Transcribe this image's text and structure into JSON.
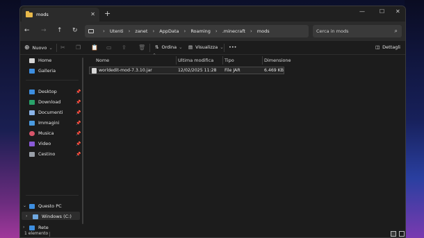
{
  "window": {
    "tab_title": "mods",
    "new_tab_symbol": "+",
    "minimize_symbol": "—",
    "maximize_symbol": "☐",
    "close_symbol": "✕"
  },
  "nav": {
    "back": "←",
    "forward": "→",
    "up": "↑",
    "refresh": "↻"
  },
  "breadcrumb": [
    "Utenti",
    "zanet",
    "AppData",
    "Roaming",
    ".minecraft",
    "mods"
  ],
  "search": {
    "placeholder": "Cerca in mods"
  },
  "toolbar": {
    "new_label": "Nuovo",
    "sort_label": "Ordina",
    "view_label": "Visualizza",
    "more_label": "•••",
    "details_label": "Dettagli"
  },
  "sidebar": {
    "top_items": [
      {
        "label": "Home",
        "icon": "home-icon"
      },
      {
        "label": "Galleria",
        "icon": "gallery-icon"
      }
    ],
    "pinned_items": [
      {
        "label": "Desktop",
        "icon": "desktop-icon",
        "color": "#3d8ee0"
      },
      {
        "label": "Download",
        "icon": "download-icon",
        "color": "#29a36a"
      },
      {
        "label": "Documenti",
        "icon": "document-icon",
        "color": "#8ab4e8"
      },
      {
        "label": "Immagini",
        "icon": "pictures-icon",
        "color": "#4a9be0"
      },
      {
        "label": "Musica",
        "icon": "music-icon",
        "color": "#d8556a"
      },
      {
        "label": "Video",
        "icon": "video-icon",
        "color": "#8a5ad8"
      },
      {
        "label": "Cestino",
        "icon": "recycle-bin-icon",
        "color": "#9aa0a8"
      }
    ],
    "this_pc": "Questo PC",
    "drive": "Windows (C:)",
    "network": "Rete"
  },
  "columns": [
    "Nome",
    "Ultima modifica",
    "Tipo",
    "Dimensione"
  ],
  "files": [
    {
      "name": "worldedit-mod-7.3.10.jar",
      "modified": "12/02/2025 11:28",
      "type": "File JAR",
      "size": "6.469 KB"
    }
  ],
  "status": {
    "count": "1 elemento"
  },
  "colors": {
    "folder": "#e8b94a",
    "window_bg": "#1c1c1c",
    "address_bg": "#3a3a3a"
  }
}
